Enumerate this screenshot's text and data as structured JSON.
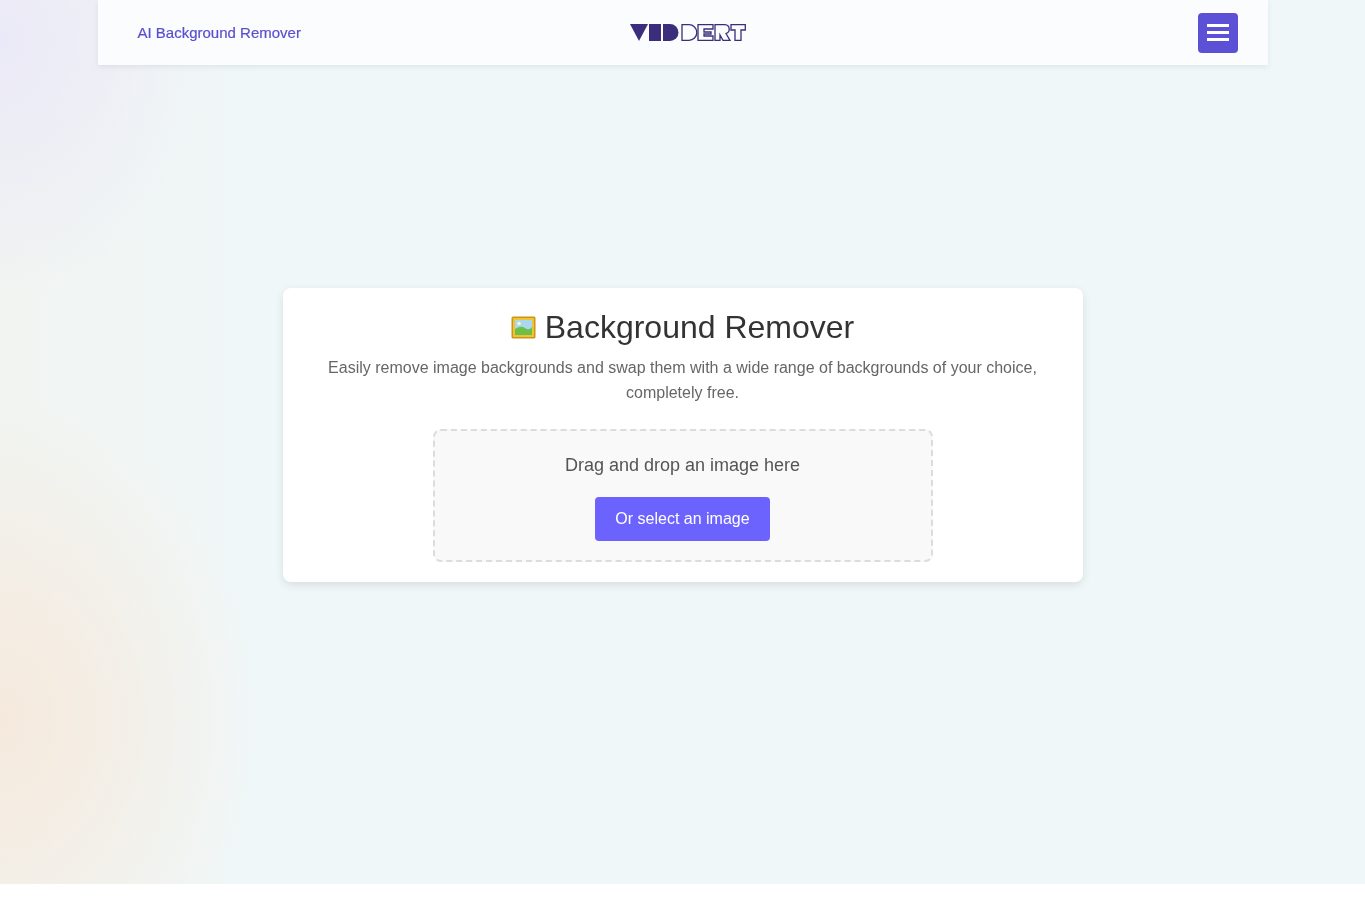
{
  "header": {
    "title": "AI Background Remover"
  },
  "card": {
    "title": "Background Remover",
    "description": "Easily remove image backgrounds and swap them with a wide range of backgrounds of your choice, completely free.",
    "drop_zone": {
      "prompt": "Drag and drop an image here",
      "button": "Or select an image"
    }
  }
}
